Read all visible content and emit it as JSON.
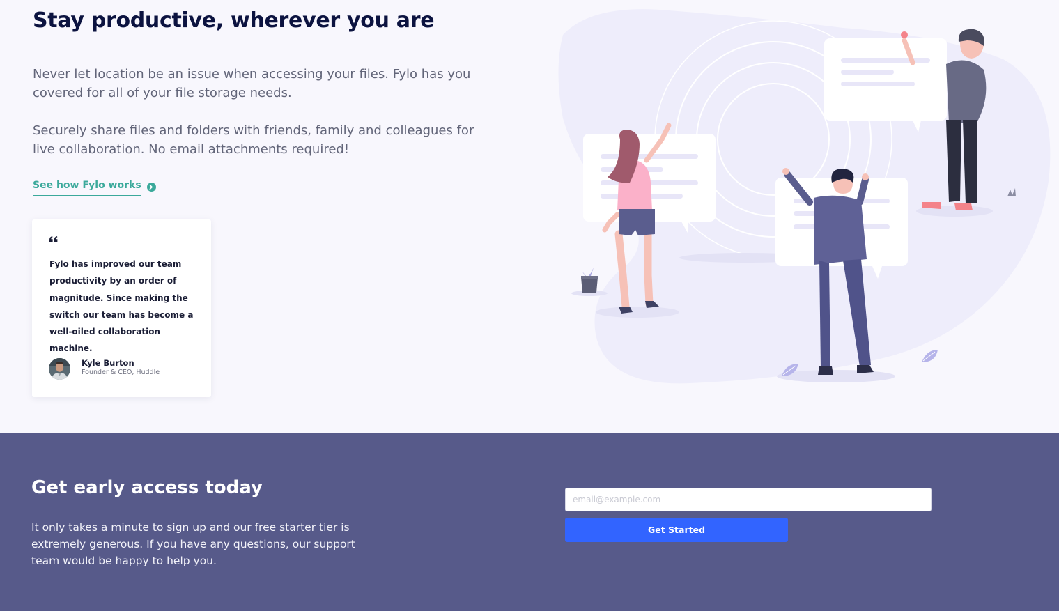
{
  "hero": {
    "title": "Stay productive, wherever you are",
    "paragraph_1": "Never let location be an issue when accessing your files. Fylo has you covered for all of your file storage needs.",
    "paragraph_2": "Securely share files and folders with friends, family and colleagues for live collaboration. No email attachments required!",
    "link_label": "See how Fylo works",
    "link_icon": "arrow-right-circle-icon"
  },
  "testimonial": {
    "quote_icon": "quote-icon",
    "quote": "Fylo has improved our team productivity by an order of magnitude. Since making the switch our team has become a well-oiled collaboration machine.",
    "name": "Kyle Burton",
    "role": "Founder & CEO, Huddle"
  },
  "illustration": {
    "name": "productive-people-illustration"
  },
  "cta": {
    "title": "Get early access today",
    "text": "It only takes a minute to sign up and our free starter tier is extremely generous. If you have any questions, our support team would be happy to help you.",
    "email_placeholder": "email@example.com",
    "email_value": "",
    "button_label": "Get Started"
  },
  "colors": {
    "background": "#f8f7fd",
    "title": "#0c1340",
    "accent_teal": "#3ba99b",
    "cta_background": "#575a8a",
    "button": "#3264ff"
  }
}
